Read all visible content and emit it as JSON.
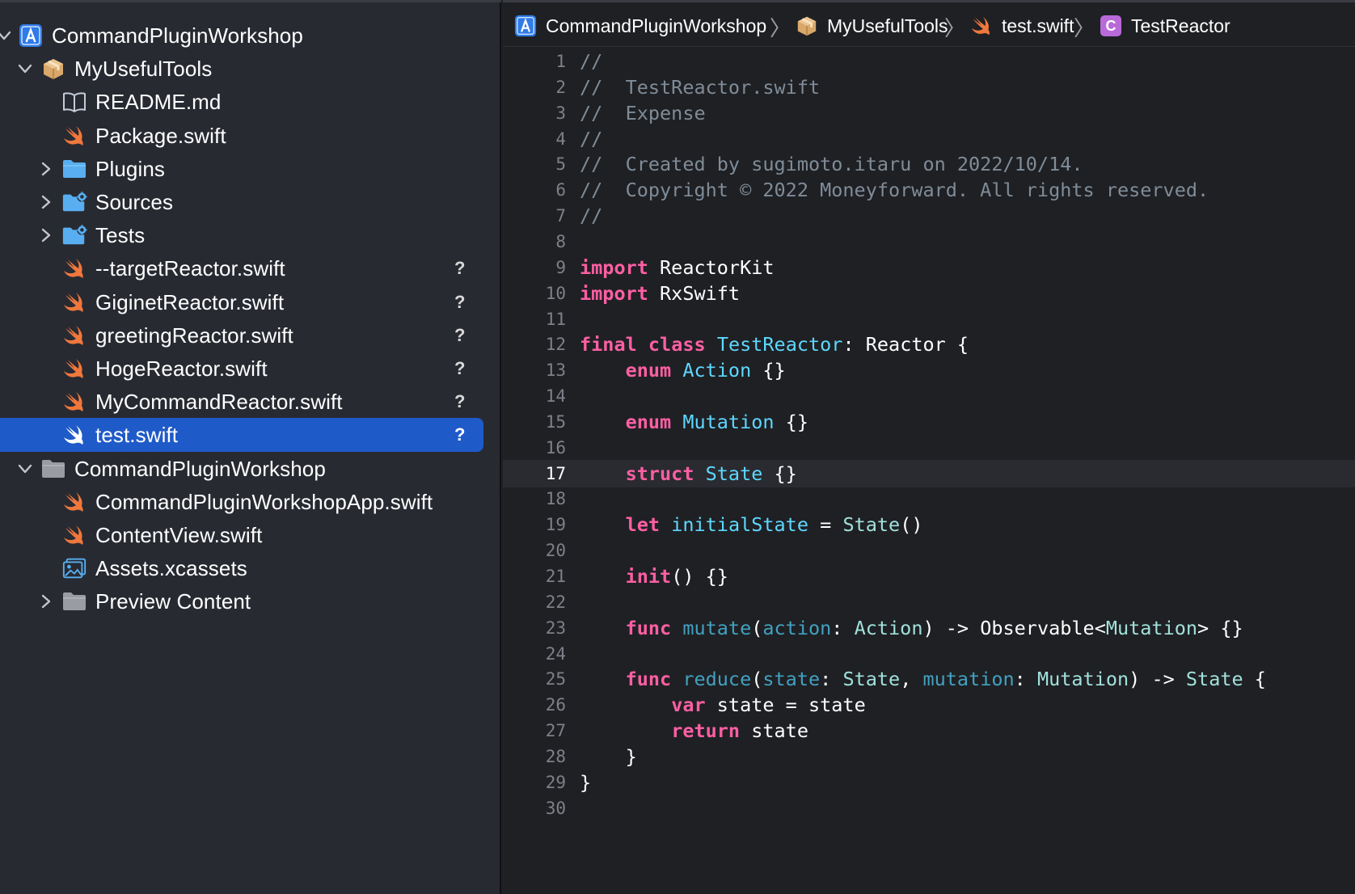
{
  "colors": {
    "navigator_bg": "#282a32",
    "selection": "#1f5ac9",
    "editor_bg": "#1f2024",
    "swift_icon": "#f0783c",
    "folder_icon": "#58aef0",
    "keyword": "#fc5fa3",
    "type_decl": "#5dd8ff",
    "comment": "#7f8c98"
  },
  "navigator": {
    "items": [
      {
        "label": "CommandPluginWorkshop",
        "icon": "xcode-project-icon",
        "disclosure": "expanded"
      },
      {
        "label": "MyUsefulTools",
        "icon": "package-icon",
        "disclosure": "expanded"
      },
      {
        "label": "README.md",
        "icon": "book-icon",
        "disclosure": "none"
      },
      {
        "label": "Package.swift",
        "icon": "swift-icon",
        "disclosure": "none"
      },
      {
        "label": "Plugins",
        "icon": "folder-icon",
        "disclosure": "collapsed"
      },
      {
        "label": "Sources",
        "icon": "source-folder-icon",
        "disclosure": "collapsed"
      },
      {
        "label": "Tests",
        "icon": "source-folder-icon",
        "disclosure": "collapsed"
      },
      {
        "label": "--targetReactor.swift",
        "icon": "swift-icon",
        "disclosure": "none",
        "status": "?"
      },
      {
        "label": "GiginetReactor.swift",
        "icon": "swift-icon",
        "disclosure": "none",
        "status": "?"
      },
      {
        "label": "greetingReactor.swift",
        "icon": "swift-icon",
        "disclosure": "none",
        "status": "?"
      },
      {
        "label": "HogeReactor.swift",
        "icon": "swift-icon",
        "disclosure": "none",
        "status": "?"
      },
      {
        "label": "MyCommandReactor.swift",
        "icon": "swift-icon",
        "disclosure": "none",
        "status": "?"
      },
      {
        "label": "test.swift",
        "icon": "swift-icon",
        "disclosure": "none",
        "status": "?",
        "selected": true
      },
      {
        "label": "CommandPluginWorkshop",
        "icon": "group-folder-icon",
        "disclosure": "expanded"
      },
      {
        "label": "CommandPluginWorkshopApp.swift",
        "icon": "swift-icon",
        "disclosure": "none"
      },
      {
        "label": "ContentView.swift",
        "icon": "swift-icon",
        "disclosure": "none"
      },
      {
        "label": "Assets.xcassets",
        "icon": "assets-icon",
        "disclosure": "none"
      },
      {
        "label": "Preview Content",
        "icon": "group-folder-icon",
        "disclosure": "collapsed"
      }
    ]
  },
  "jumpbar": {
    "crumbs": [
      {
        "label": "CommandPluginWorkshop",
        "icon": "xcode-project-icon"
      },
      {
        "label": "MyUsefulTools",
        "icon": "package-icon"
      },
      {
        "label": "test.swift",
        "icon": "swift-icon"
      },
      {
        "label": "TestReactor",
        "icon": "class-c-icon",
        "badge": "C"
      }
    ],
    "separator": "〉"
  },
  "editor": {
    "current_line": 17,
    "lines": [
      {
        "n": "1",
        "tokens": [
          [
            "//",
            "comment"
          ]
        ]
      },
      {
        "n": "2",
        "tokens": [
          [
            "//  TestReactor.swift",
            "comment"
          ]
        ]
      },
      {
        "n": "3",
        "tokens": [
          [
            "//  Expense",
            "comment"
          ]
        ]
      },
      {
        "n": "4",
        "tokens": [
          [
            "//",
            "comment"
          ]
        ]
      },
      {
        "n": "5",
        "tokens": [
          [
            "//  Created by sugimoto.itaru on 2022/10/14.",
            "comment"
          ]
        ]
      },
      {
        "n": "6",
        "tokens": [
          [
            "//  Copyright © 2022 Moneyforward. All rights reserved.",
            "comment"
          ]
        ]
      },
      {
        "n": "7",
        "tokens": [
          [
            "//",
            "comment"
          ]
        ]
      },
      {
        "n": "8",
        "tokens": []
      },
      {
        "n": "9",
        "tokens": [
          [
            "import",
            "keyword"
          ],
          [
            " ReactorKit",
            "plain"
          ]
        ]
      },
      {
        "n": "10",
        "tokens": [
          [
            "import",
            "keyword"
          ],
          [
            " RxSwift",
            "plain"
          ]
        ]
      },
      {
        "n": "11",
        "tokens": []
      },
      {
        "n": "12",
        "tokens": [
          [
            "final",
            "keyword"
          ],
          [
            " ",
            "plain"
          ],
          [
            "class",
            "keyword"
          ],
          [
            " ",
            "plain"
          ],
          [
            "TestReactor",
            "typedecl"
          ],
          [
            ": Reactor {",
            "plain"
          ]
        ]
      },
      {
        "n": "13",
        "tokens": [
          [
            "    ",
            "plain"
          ],
          [
            "enum",
            "keyword"
          ],
          [
            " ",
            "plain"
          ],
          [
            "Action",
            "typedecl"
          ],
          [
            " {}",
            "plain"
          ]
        ]
      },
      {
        "n": "14",
        "tokens": []
      },
      {
        "n": "15",
        "tokens": [
          [
            "    ",
            "plain"
          ],
          [
            "enum",
            "keyword"
          ],
          [
            " ",
            "plain"
          ],
          [
            "Mutation",
            "typedecl"
          ],
          [
            " {}",
            "plain"
          ]
        ]
      },
      {
        "n": "16",
        "tokens": []
      },
      {
        "n": "17",
        "tokens": [
          [
            "    ",
            "plain"
          ],
          [
            "struct",
            "keyword"
          ],
          [
            " ",
            "plain"
          ],
          [
            "State",
            "typedecl"
          ],
          [
            " {}",
            "plain"
          ]
        ]
      },
      {
        "n": "18",
        "tokens": []
      },
      {
        "n": "19",
        "tokens": [
          [
            "    ",
            "plain"
          ],
          [
            "let",
            "keyword"
          ],
          [
            " ",
            "plain"
          ],
          [
            "initialState",
            "typedecl"
          ],
          [
            " = ",
            "plain"
          ],
          [
            "State",
            "typeother"
          ],
          [
            "()",
            "plain"
          ]
        ]
      },
      {
        "n": "20",
        "tokens": []
      },
      {
        "n": "21",
        "tokens": [
          [
            "    ",
            "plain"
          ],
          [
            "init",
            "keyword"
          ],
          [
            "() {}",
            "plain"
          ]
        ]
      },
      {
        "n": "22",
        "tokens": []
      },
      {
        "n": "23",
        "tokens": [
          [
            "    ",
            "plain"
          ],
          [
            "func",
            "keyword"
          ],
          [
            " ",
            "plain"
          ],
          [
            "mutate",
            "funcdecl"
          ],
          [
            "(",
            "plain"
          ],
          [
            "action",
            "funcdecl"
          ],
          [
            ": ",
            "plain"
          ],
          [
            "Action",
            "typeother"
          ],
          [
            ") -> Observable<",
            "plain"
          ],
          [
            "Mutation",
            "typeother"
          ],
          [
            "> {}",
            "plain"
          ]
        ]
      },
      {
        "n": "24",
        "tokens": []
      },
      {
        "n": "25",
        "tokens": [
          [
            "    ",
            "plain"
          ],
          [
            "func",
            "keyword"
          ],
          [
            " ",
            "plain"
          ],
          [
            "reduce",
            "funcdecl"
          ],
          [
            "(",
            "plain"
          ],
          [
            "state",
            "funcdecl"
          ],
          [
            ": ",
            "plain"
          ],
          [
            "State",
            "typeother"
          ],
          [
            ", ",
            "plain"
          ],
          [
            "mutation",
            "funcdecl"
          ],
          [
            ": ",
            "plain"
          ],
          [
            "Mutation",
            "typeother"
          ],
          [
            ") -> ",
            "plain"
          ],
          [
            "State",
            "typeother"
          ],
          [
            " {",
            "plain"
          ]
        ]
      },
      {
        "n": "26",
        "tokens": [
          [
            "        ",
            "plain"
          ],
          [
            "var",
            "keyword"
          ],
          [
            " state = state",
            "plain"
          ]
        ]
      },
      {
        "n": "27",
        "tokens": [
          [
            "        ",
            "plain"
          ],
          [
            "return",
            "keyword"
          ],
          [
            " state",
            "plain"
          ]
        ]
      },
      {
        "n": "28",
        "tokens": [
          [
            "    }",
            "plain"
          ]
        ]
      },
      {
        "n": "29",
        "tokens": [
          [
            "}",
            "plain"
          ]
        ]
      },
      {
        "n": "30",
        "tokens": []
      }
    ]
  }
}
